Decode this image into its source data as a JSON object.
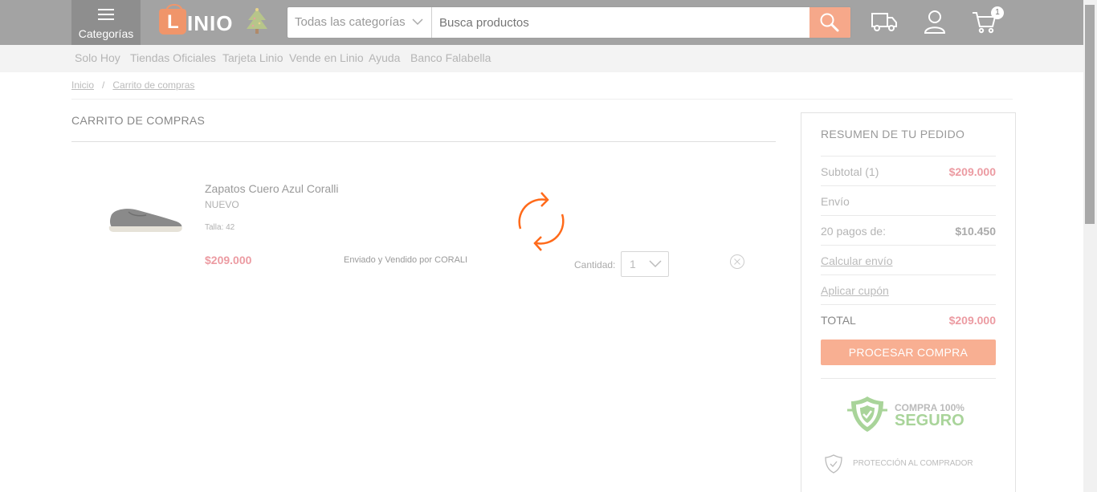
{
  "header": {
    "categories_label": "Categorías",
    "logo_letter": "L",
    "logo_text": "INIO",
    "search_category": "Todas las categorías",
    "search_placeholder": "Busca productos",
    "cart_count": "1"
  },
  "nav": {
    "items": [
      "Solo Hoy",
      "Tiendas Oficiales",
      "Tarjeta Linio",
      "Vende en Linio",
      "Ayuda",
      "Banco Falabella"
    ]
  },
  "breadcrumb": {
    "home": "Inicio",
    "separator": "/",
    "current": "Carrito de compras"
  },
  "cart": {
    "title": "CARRITO DE COMPRAS",
    "item": {
      "name": "Zapatos Cuero Azul Coralli",
      "condition": "NUEVO",
      "size": "Talla: 42",
      "price": "$209.000",
      "seller": "Enviado y Vendido por CORALI",
      "quantity_label": "Cantidad:",
      "quantity": "1"
    }
  },
  "summary": {
    "title": "RESUMEN DE TU PEDIDO",
    "subtotal_label": "Subtotal (1)",
    "subtotal_value": "$209.000",
    "shipping_label": "Envío",
    "installments_label": "20 pagos de:",
    "installments_value": "$10.450",
    "calc_shipping": "Calcular envío",
    "apply_coupon": "Aplicar cupón",
    "total_label": "TOTAL",
    "total_value": "$209.000",
    "process_button": "PROCESAR COMPRA",
    "secure_line1": "COMPRA 100%",
    "secure_line2": "SEGURO",
    "protection": "PROTECCIÓN AL COMPRADOR"
  },
  "colors": {
    "accent": "#f6a88a",
    "price": "#ec9ba2",
    "spinner": "#ff6a1a",
    "secure_green": "#a9d49a"
  }
}
